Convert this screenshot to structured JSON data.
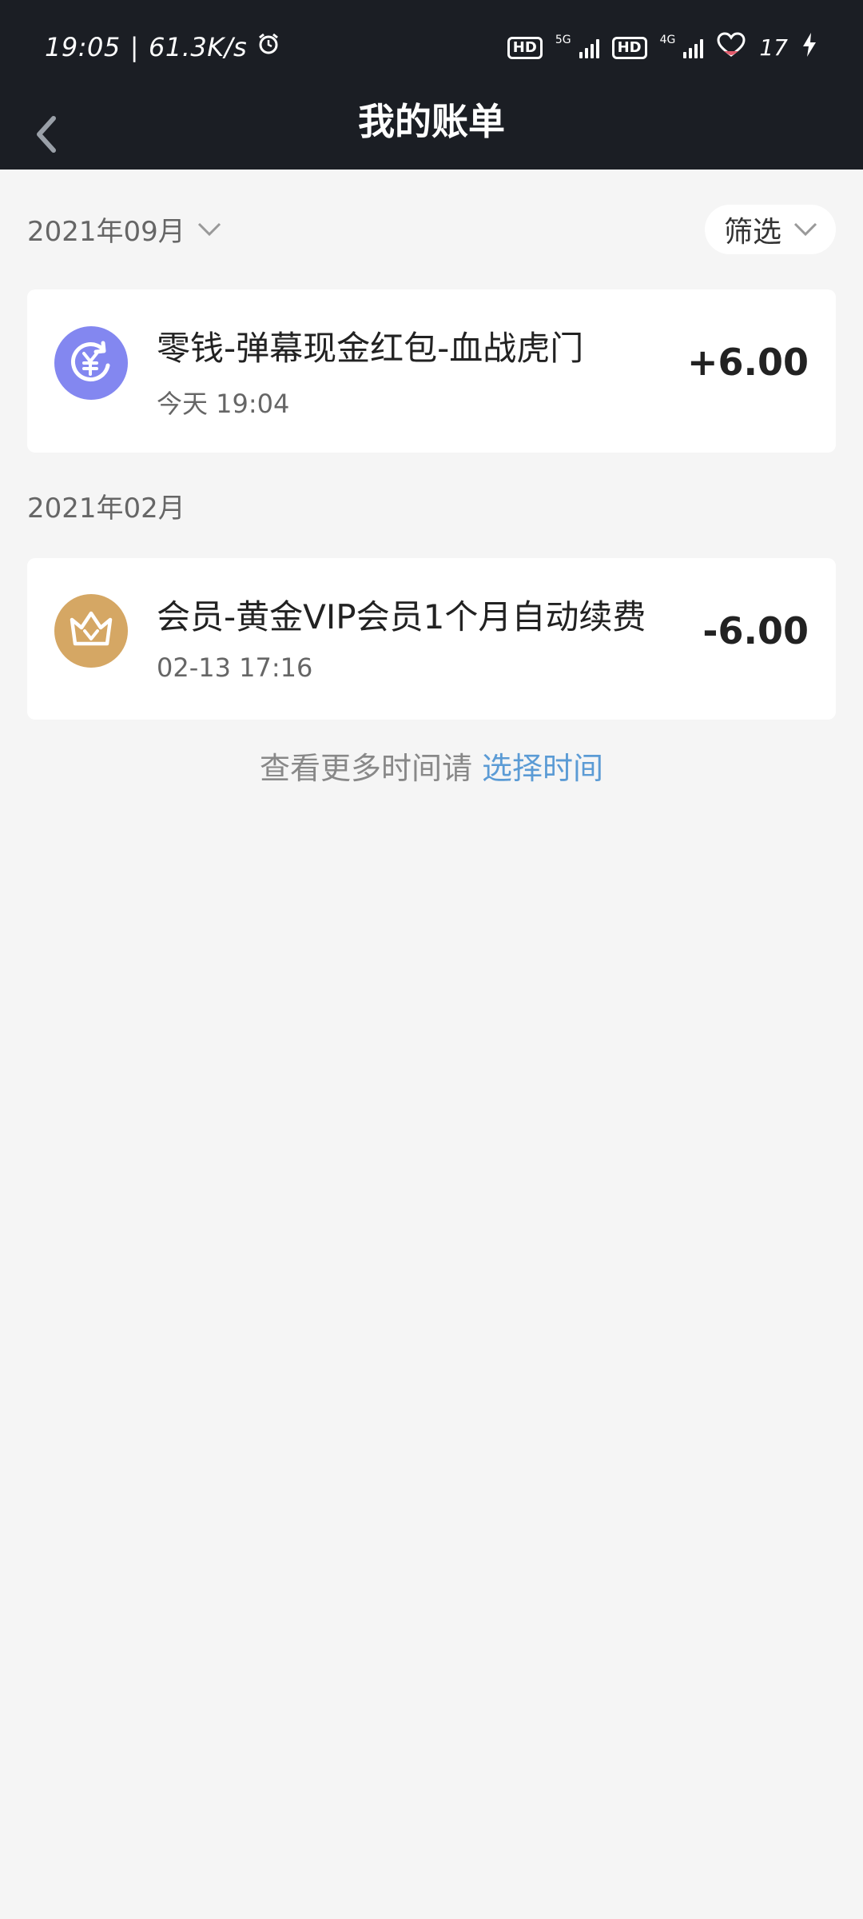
{
  "status_bar": {
    "time": "19:05",
    "separator": "|",
    "net_speed": "61.3K/s",
    "hd_label_1": "HD",
    "sig_1_label": "5G",
    "hd_label_2": "HD",
    "sig_2_label": "4G",
    "battery_level": "17"
  },
  "nav": {
    "title": "我的账单"
  },
  "filter": {
    "label": "筛选"
  },
  "groups": [
    {
      "month": "2021年09月",
      "items": [
        {
          "title": "零钱-弹幕现金红包-血战虎门",
          "time": "今天 19:04",
          "amount": "+6.00",
          "icon": "yuan-refund-icon",
          "icon_color": "#8387f0"
        }
      ]
    },
    {
      "month": "2021年02月",
      "items": [
        {
          "title": "会员-黄金VIP会员1个月自动续费",
          "time": "02-13 17:16",
          "amount": "-6.00",
          "icon": "crown-vip-icon",
          "icon_color": "#d5a764"
        }
      ]
    }
  ],
  "footer": {
    "prefix": "查看更多时间请",
    "link": "选择时间"
  },
  "colors": {
    "header_bg": "#1b1e24",
    "page_bg": "#f5f5f5",
    "link": "#5b9bd5"
  }
}
